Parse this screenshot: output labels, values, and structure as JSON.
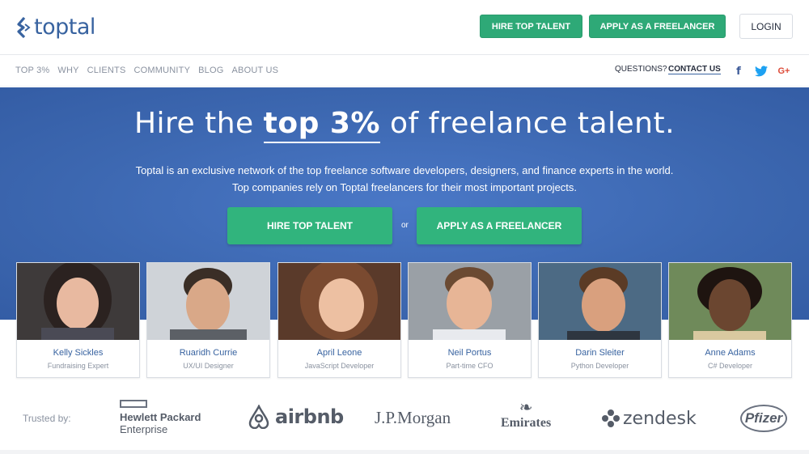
{
  "header": {
    "logo_text": "toptal",
    "hire_label": "HIRE TOP TALENT",
    "apply_label": "APPLY AS A FREELANCER",
    "login_label": "LOGIN"
  },
  "nav": {
    "items": [
      {
        "label": "TOP 3%"
      },
      {
        "label": "WHY"
      },
      {
        "label": "CLIENTS"
      },
      {
        "label": "COMMUNITY"
      },
      {
        "label": "BLOG"
      },
      {
        "label": "ABOUT US"
      }
    ],
    "questions_label": "QUESTIONS?",
    "contact_label": "CONTACT US",
    "social": {
      "facebook": "f",
      "twitter": "twitter-icon",
      "google": "G+"
    }
  },
  "hero": {
    "headline_pre": "Hire the ",
    "headline_em": "top 3%",
    "headline_post": " of freelance talent.",
    "sub_line1": "Toptal is an exclusive network of the top freelance software developers, designers, and finance experts in the world.",
    "sub_line2": "Top companies rely on Toptal freelancers for their most important projects.",
    "hire_label": "HIRE TOP TALENT",
    "or_label": "or",
    "apply_label": "APPLY AS A FREELANCER"
  },
  "talent": [
    {
      "name": "Kelly Sickles",
      "role": "Fundraising Expert"
    },
    {
      "name": "Ruaridh Currie",
      "role": "UX/UI Designer"
    },
    {
      "name": "April Leone",
      "role": "JavaScript Developer"
    },
    {
      "name": "Neil Portus",
      "role": "Part-time CFO"
    },
    {
      "name": "Darin Sleiter",
      "role": "Python Developer"
    },
    {
      "name": "Anne Adams",
      "role": "C# Developer"
    }
  ],
  "trusted": {
    "label": "Trusted by:",
    "hpe_line1": "Hewlett Packard",
    "hpe_line2": "Enterprise",
    "airbnb": "airbnb",
    "jpmorgan": "J.P.Morgan",
    "emirates": "Emirates",
    "zendesk": "zendesk",
    "pfizer": "Pfizer"
  },
  "colors": {
    "brand_blue": "#3863a0",
    "hero_blue": "#3c67b0",
    "green": "#2ea977"
  }
}
